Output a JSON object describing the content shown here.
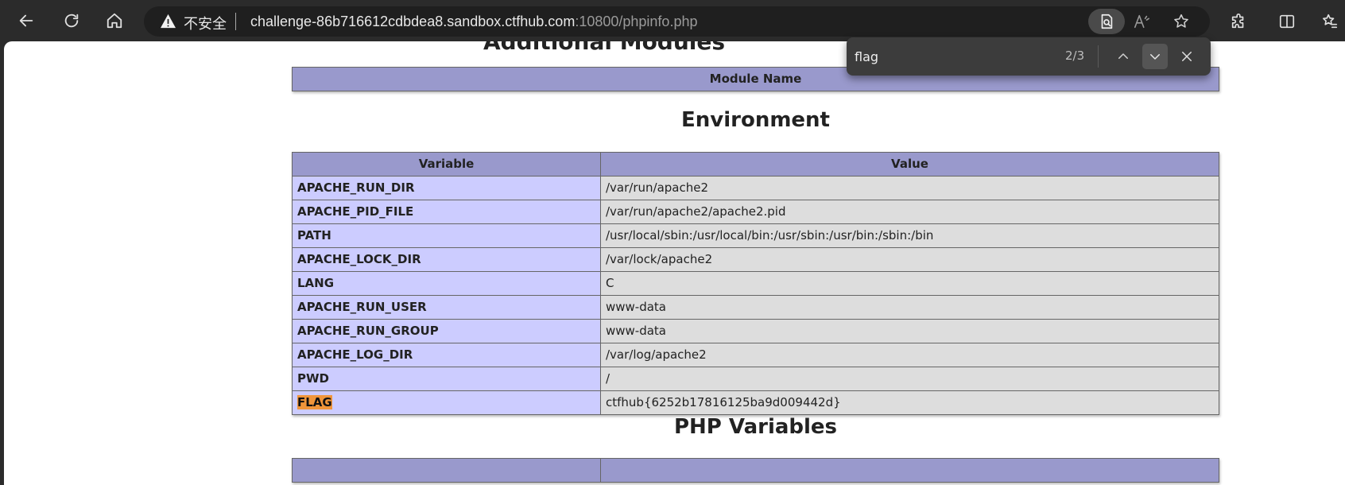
{
  "browser": {
    "security_label": "不安全",
    "url_main": "challenge-86b716612cdbdea8.sandbox.ctfhub.com",
    "url_rest": ":10800/phpinfo.php"
  },
  "find_bar": {
    "query": "flag",
    "count": "2/3"
  },
  "page": {
    "partial_heading": "Additional Modules",
    "modules_table": {
      "header": "Module Name"
    },
    "environment": {
      "heading": "Environment",
      "col_variable": "Variable",
      "col_value": "Value",
      "rows": [
        {
          "name": "APACHE_RUN_DIR",
          "value": "/var/run/apache2"
        },
        {
          "name": "APACHE_PID_FILE",
          "value": "/var/run/apache2/apache2.pid"
        },
        {
          "name": "PATH",
          "value": "/usr/local/sbin:/usr/local/bin:/usr/sbin:/usr/bin:/sbin:/bin"
        },
        {
          "name": "APACHE_LOCK_DIR",
          "value": "/var/lock/apache2"
        },
        {
          "name": "LANG",
          "value": "C"
        },
        {
          "name": "APACHE_RUN_USER",
          "value": "www-data"
        },
        {
          "name": "APACHE_RUN_GROUP",
          "value": "www-data"
        },
        {
          "name": "APACHE_LOG_DIR",
          "value": "/var/log/apache2"
        },
        {
          "name": "PWD",
          "value": "/"
        },
        {
          "name": "FLAG",
          "value": "ctfhub{6252b17816125ba9d009442d}"
        }
      ]
    },
    "php_variables": {
      "heading": "PHP Variables"
    }
  },
  "colors": {
    "header_bg": "#9999cc",
    "key_bg": "#ccccff",
    "value_bg": "#dddddd",
    "highlight": "#f0953a",
    "chrome_bg": "#2b2b2b"
  },
  "icons": {
    "back": "back-arrow-icon",
    "refresh": "refresh-icon",
    "home": "home-icon",
    "warning": "warning-icon",
    "find": "find-in-page-icon",
    "read_aloud": "read-aloud-icon",
    "favorite": "star-icon",
    "extensions": "puzzle-icon",
    "split": "split-screen-icon",
    "favorites": "favorites-icon",
    "find_prev": "chevron-up-icon",
    "find_next": "chevron-down-icon",
    "find_close": "close-icon"
  }
}
